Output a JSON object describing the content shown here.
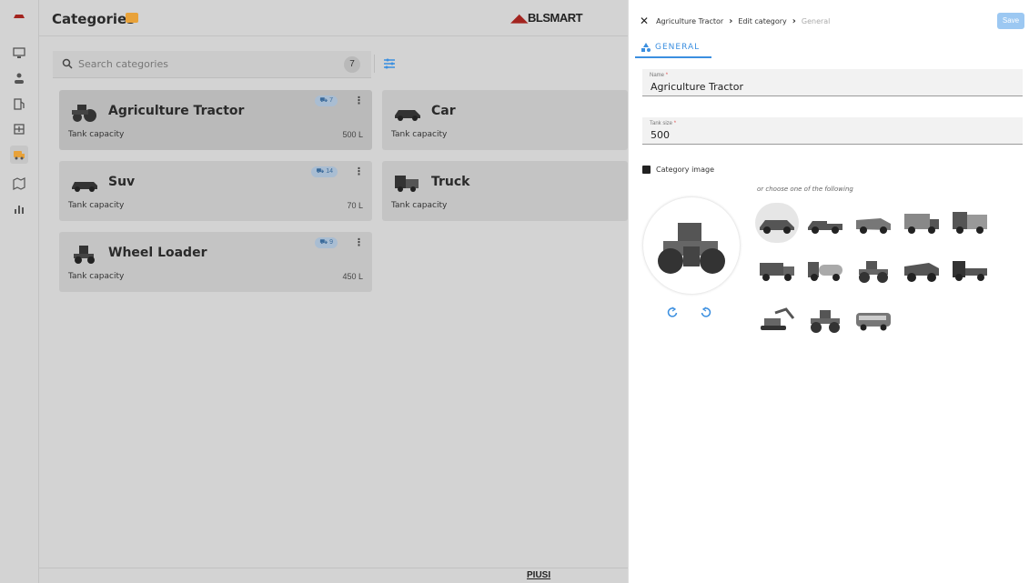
{
  "header": {
    "title": "Categories",
    "brand_part1": "",
    "brand_part2": "BLSMART"
  },
  "rail": {
    "icons": [
      "car-logo-icon",
      "dashboard-icon",
      "person-icon",
      "pump-icon",
      "tank-icon",
      "vehicle-icon",
      "map-icon",
      "chart-icon"
    ]
  },
  "search": {
    "placeholder": "Search categories",
    "count": "7"
  },
  "cards": [
    {
      "name": "Agriculture Tractor",
      "label": "Tank capacity",
      "capacity": "500 L",
      "chip": "7"
    },
    {
      "name": "Car",
      "label": "Tank capacity"
    },
    {
      "name": "Suv",
      "label": "Tank capacity",
      "capacity": "70 L",
      "chip": "14"
    },
    {
      "name": "Truck",
      "label": "Tank capacity"
    },
    {
      "name": "Wheel Loader",
      "label": "Tank capacity",
      "capacity": "450 L",
      "chip": "9"
    }
  ],
  "footer": {
    "logo": "PIUSI"
  },
  "panel": {
    "breadcrumb": [
      "Agriculture Tractor",
      "Edit category",
      "General"
    ],
    "save_label": "Save",
    "tab": "GENERAL",
    "name_label": "Name",
    "name_value": "Agriculture Tractor",
    "tank_label": "Tank size",
    "tank_value": "500",
    "required_mark": "*",
    "image_label": "Category image",
    "choose_text": "or choose one of the following"
  },
  "colors": {
    "accent": "#3b8fe0",
    "save_bg": "#9cc8f2",
    "brand_red": "#a3241f",
    "header_icon": "#e8a23a"
  }
}
